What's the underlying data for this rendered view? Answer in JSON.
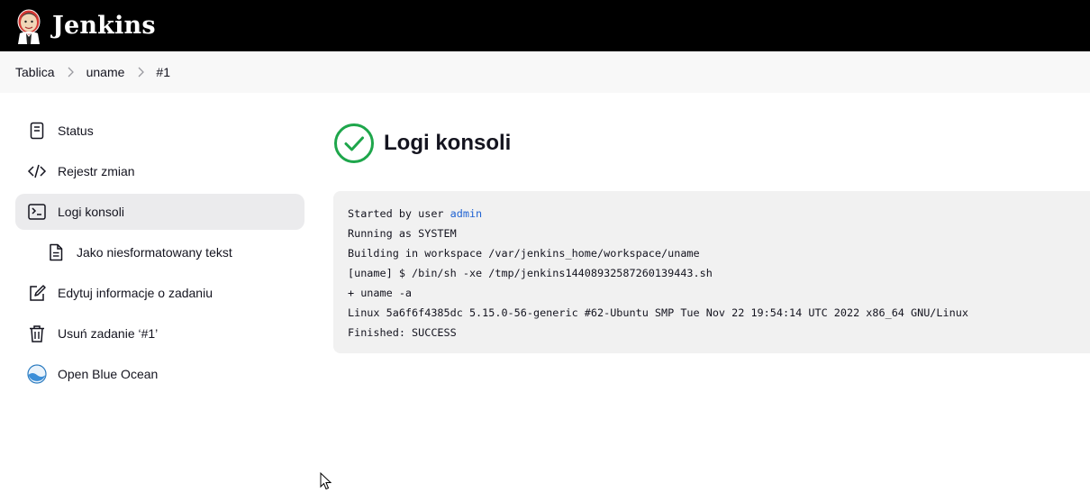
{
  "header": {
    "brand": "Jenkins",
    "logo_icon": "jenkins-butler-logo"
  },
  "breadcrumbs": [
    {
      "label": "Tablica"
    },
    {
      "label": "uname"
    },
    {
      "label": "#1"
    }
  ],
  "sidebar": {
    "items": [
      {
        "label": "Status",
        "icon": "document-icon"
      },
      {
        "label": "Rejestr zmian",
        "icon": "code-icon"
      },
      {
        "label": "Logi konsoli",
        "icon": "terminal-icon",
        "active": true
      },
      {
        "label": "Jako niesformatowany tekst",
        "icon": "file-text-icon"
      },
      {
        "label": "Edytuj informacje o zadaniu",
        "icon": "edit-icon"
      },
      {
        "label": "Usuń zadanie ‘#1’",
        "icon": "trash-icon"
      },
      {
        "label": "Open Blue Ocean",
        "icon": "blue-ocean-icon"
      }
    ]
  },
  "main": {
    "title": "Logi konsoli",
    "status": "success",
    "status_color": "#1ea64b"
  },
  "console": {
    "line0_prefix": "Started by user ",
    "line0_user": "admin",
    "lines": [
      "Running as SYSTEM",
      "Building in workspace /var/jenkins_home/workspace/uname",
      "[uname] $ /bin/sh -xe /tmp/jenkins14408932587260139443.sh",
      "+ uname -a",
      "Linux 5a6f6f4385dc 5.15.0-56-generic #62-Ubuntu SMP Tue Nov 22 19:54:14 UTC 2022 x86_64 GNU/Linux",
      "Finished: SUCCESS"
    ]
  },
  "colors": {
    "header_bg": "#000000",
    "link": "#2063d2",
    "active_bg": "#ebebed",
    "console_bg": "#f1f1f1"
  }
}
